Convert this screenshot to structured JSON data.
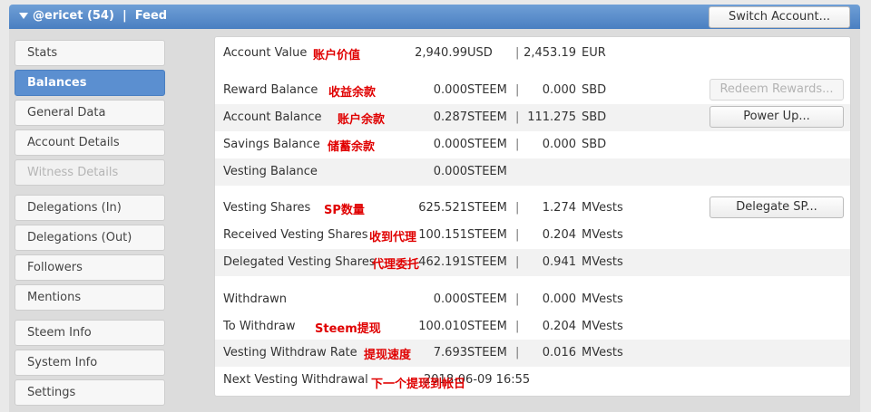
{
  "header": {
    "title": "@ericet (54)  |  Feed",
    "switch_label": "Switch Account..."
  },
  "tabs": [
    {
      "label": "Stats",
      "state": "normal"
    },
    {
      "label": "Balances",
      "state": "active"
    },
    {
      "label": "General Data",
      "state": "normal"
    },
    {
      "label": "Account Details",
      "state": "normal"
    },
    {
      "label": "Witness Details",
      "state": "disabled"
    },
    {
      "label": "Delegations (In)",
      "state": "normal"
    },
    {
      "label": "Delegations (Out)",
      "state": "normal"
    },
    {
      "label": "Followers",
      "state": "normal"
    },
    {
      "label": "Mentions",
      "state": "normal"
    },
    {
      "label": "Steem Info",
      "state": "normal"
    },
    {
      "label": "System Info",
      "state": "normal"
    },
    {
      "label": "Settings",
      "state": "normal"
    }
  ],
  "rows": {
    "account_value": {
      "label": "Account Value",
      "note": "账户价值",
      "v1": "2,940.99",
      "u1": "USD",
      "sep": "|",
      "v2": "2,453.19",
      "u2": "EUR"
    },
    "reward_balance": {
      "label": "Reward Balance",
      "note": "收益余款",
      "v1": "0.000",
      "u1": "STEEM",
      "sep": "|",
      "v2": "0.000",
      "u2": "SBD",
      "button": "Redeem Rewards..."
    },
    "account_balance": {
      "label": "Account Balance",
      "note": "账户余款",
      "v1": "0.287",
      "u1": "STEEM",
      "sep": "|",
      "v2": "111.275",
      "u2": "SBD",
      "button": "Power Up..."
    },
    "savings_balance": {
      "label": "Savings Balance",
      "note": "储蓄余款",
      "v1": "0.000",
      "u1": "STEEM",
      "sep": "|",
      "v2": "0.000",
      "u2": "SBD"
    },
    "vesting_balance": {
      "label": "Vesting Balance",
      "v1": "0.000",
      "u1": "STEEM"
    },
    "vesting_shares": {
      "label": "Vesting Shares",
      "note": "SP数量",
      "v1": "625.521",
      "u1": "STEEM",
      "sep": "|",
      "v2": "1.274",
      "u2": "MVests",
      "button": "Delegate SP..."
    },
    "received_vesting": {
      "label": "Received Vesting Shares",
      "note": "收到代理",
      "v1": "100.151",
      "u1": "STEEM",
      "sep": "|",
      "v2": "0.204",
      "u2": "MVests"
    },
    "delegated_vesting": {
      "label": "Delegated Vesting Shares",
      "note": "代理委托",
      "v1": "462.191",
      "u1": "STEEM",
      "sep": "|",
      "v2": "0.941",
      "u2": "MVests"
    },
    "withdrawn": {
      "label": "Withdrawn",
      "v1": "0.000",
      "u1": "STEEM",
      "sep": "|",
      "v2": "0.000",
      "u2": "MVests"
    },
    "to_withdraw": {
      "label": "To Withdraw",
      "note": "Steem提现",
      "v1": "100.010",
      "u1": "STEEM",
      "sep": "|",
      "v2": "0.204",
      "u2": "MVests"
    },
    "withdraw_rate": {
      "label": "Vesting Withdraw Rate",
      "note": "提现速度",
      "v1": "7.693",
      "u1": "STEEM",
      "sep": "|",
      "v2": "0.016",
      "u2": "MVests"
    },
    "next_withdrawal": {
      "label": "Next Vesting Withdrawal",
      "note": "下一个提现到帐日",
      "value": "2018-06-09 16:55"
    }
  }
}
